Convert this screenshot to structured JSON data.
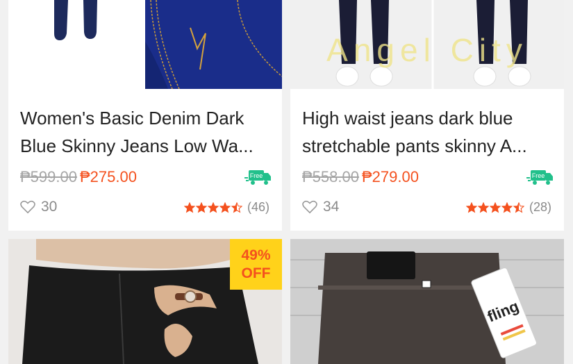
{
  "products": [
    {
      "title": "Women's Basic Denim Dark Blue Skinny Jeans Low Wa...",
      "old_price": "₱599.00",
      "new_price": "₱275.00",
      "free_label": "Free",
      "likes": "30",
      "rating_value": 4.5,
      "reviews": "(46)"
    },
    {
      "title": "High waist jeans dark blue stretchable pants skinny A...",
      "old_price": "₱558.00",
      "new_price": "₱279.00",
      "free_label": "Free",
      "likes": "34",
      "rating_value": 4.5,
      "reviews": "(28)",
      "watermark": "Angel City"
    },
    {
      "discount_pct": "49%",
      "discount_off": "OFF"
    },
    {
      "tag_text": "fling"
    }
  ],
  "colors": {
    "accent": "#f4511e",
    "free_green": "#21c08b",
    "badge_yellow": "#ffd21a"
  }
}
